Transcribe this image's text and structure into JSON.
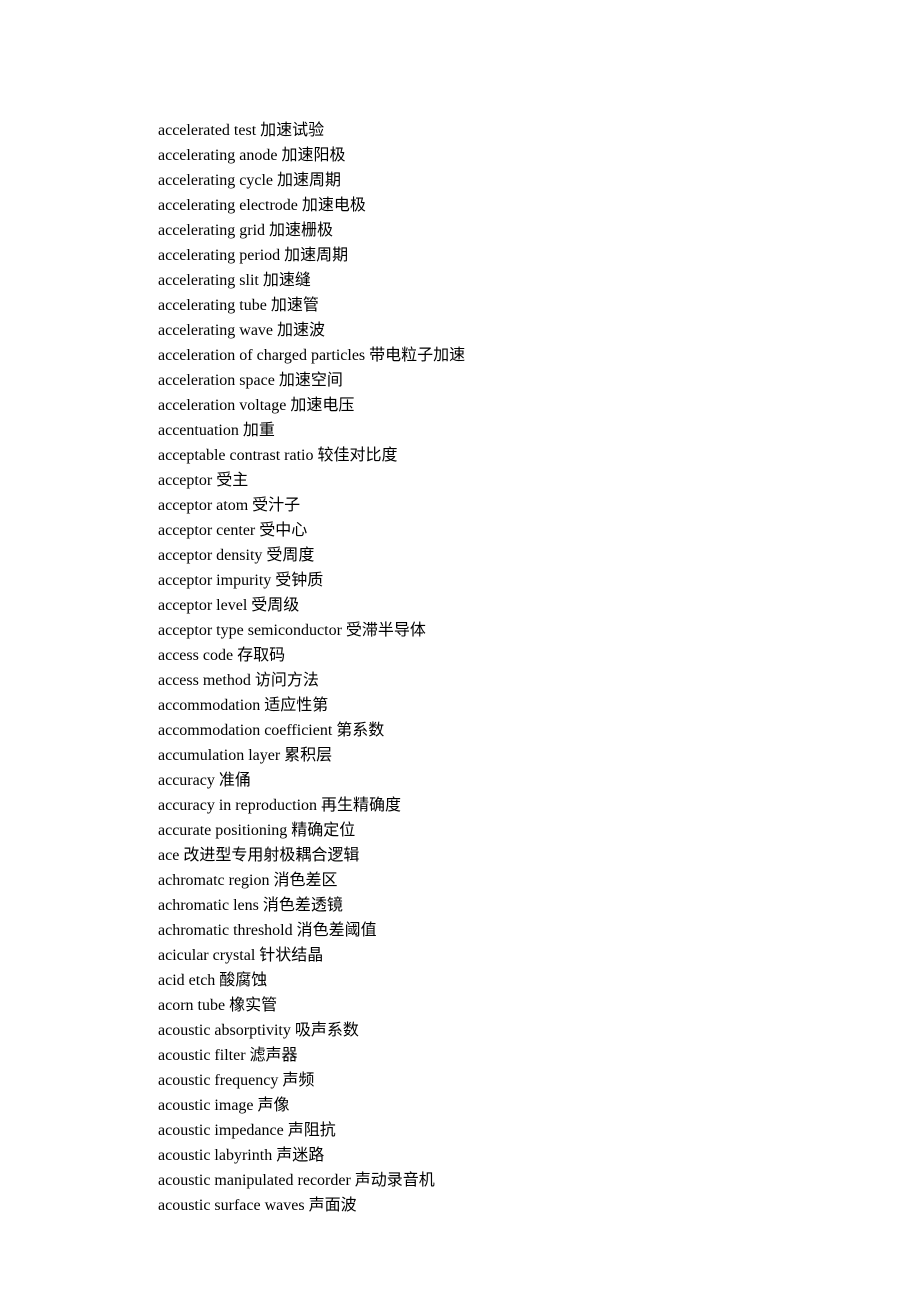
{
  "entries": [
    {
      "en": "accelerated test",
      "zh": "加速试验"
    },
    {
      "en": "accelerating anode",
      "zh": "加速阳极"
    },
    {
      "en": "accelerating cycle",
      "zh": "加速周期"
    },
    {
      "en": "accelerating electrode",
      "zh": "加速电极"
    },
    {
      "en": "accelerating grid",
      "zh": "加速栅极"
    },
    {
      "en": "accelerating period",
      "zh": "加速周期"
    },
    {
      "en": "accelerating slit",
      "zh": "加速缝"
    },
    {
      "en": "accelerating tube",
      "zh": "加速管"
    },
    {
      "en": "accelerating wave",
      "zh": "加速波"
    },
    {
      "en": "acceleration of charged particles",
      "zh": "带电粒子加速"
    },
    {
      "en": "acceleration space",
      "zh": "加速空间"
    },
    {
      "en": "acceleration voltage",
      "zh": "加速电压"
    },
    {
      "en": "accentuation",
      "zh": "加重"
    },
    {
      "en": "acceptable contrast ratio",
      "zh": "较佳对比度"
    },
    {
      "en": "acceptor",
      "zh": "受主"
    },
    {
      "en": "acceptor atom",
      "zh": "受汁子"
    },
    {
      "en": "acceptor center",
      "zh": "受中心"
    },
    {
      "en": "acceptor density",
      "zh": "受周度"
    },
    {
      "en": "acceptor impurity",
      "zh": "受钟质"
    },
    {
      "en": "acceptor level",
      "zh": "受周级"
    },
    {
      "en": "acceptor type semiconductor",
      "zh": "受滞半导体"
    },
    {
      "en": "access code",
      "zh": "存取码"
    },
    {
      "en": "access method",
      "zh": "访问方法"
    },
    {
      "en": "accommodation",
      "zh": "适应性第"
    },
    {
      "en": "accommodation coefficient",
      "zh": "第系数"
    },
    {
      "en": "accumulation layer",
      "zh": "累积层"
    },
    {
      "en": "accuracy",
      "zh": "准俑"
    },
    {
      "en": "accuracy in reproduction",
      "zh": "再生精确度"
    },
    {
      "en": "accurate positioning",
      "zh": "精确定位"
    },
    {
      "en": "ace",
      "zh": "改进型专用射极耦合逻辑"
    },
    {
      "en": "achromatc region",
      "zh": "消色差区"
    },
    {
      "en": "achromatic lens",
      "zh": "消色差透镜"
    },
    {
      "en": "achromatic threshold",
      "zh": "消色差阈值"
    },
    {
      "en": "acicular crystal",
      "zh": "针状结晶"
    },
    {
      "en": "acid etch",
      "zh": "酸腐蚀"
    },
    {
      "en": "acorn tube",
      "zh": "橡实管"
    },
    {
      "en": "acoustic absorptivity",
      "zh": "吸声系数"
    },
    {
      "en": "acoustic filter",
      "zh": "滤声器"
    },
    {
      "en": "acoustic frequency",
      "zh": "声频"
    },
    {
      "en": "acoustic image",
      "zh": "声像"
    },
    {
      "en": "acoustic impedance",
      "zh": "声阻抗"
    },
    {
      "en": "acoustic labyrinth",
      "zh": "声迷路"
    },
    {
      "en": "acoustic manipulated recorder",
      "zh": "声动录音机"
    },
    {
      "en": "acoustic surface waves",
      "zh": "声面波"
    }
  ]
}
